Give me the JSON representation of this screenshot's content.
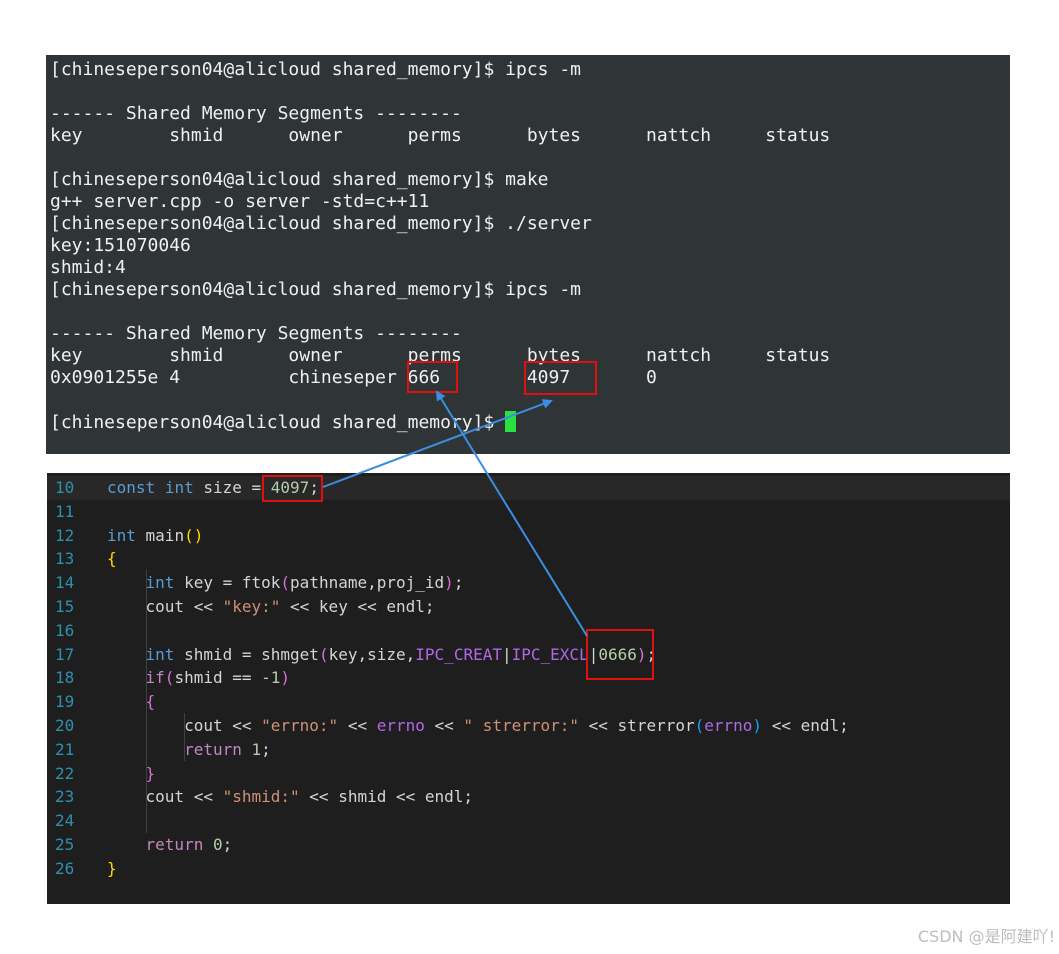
{
  "terminal": {
    "lines": [
      "[chineseperson04@alicloud shared_memory]$ ipcs -m",
      "",
      "------ Shared Memory Segments --------",
      "key        shmid      owner      perms      bytes      nattch     status",
      "",
      "[chineseperson04@alicloud shared_memory]$ make",
      "g++ server.cpp -o server -std=c++11",
      "[chineseperson04@alicloud shared_memory]$ ./server",
      "key:151070046",
      "shmid:4",
      "[chineseperson04@alicloud shared_memory]$ ipcs -m",
      "",
      "------ Shared Memory Segments --------",
      "key        shmid      owner      perms      bytes      nattch     status",
      "0x0901255e 4          chineseper 666        4097       0",
      ""
    ],
    "prompt": "[chineseperson04@alicloud shared_memory]$ ",
    "cursor_color": "#29e13f"
  },
  "editor": {
    "line_numbers": [
      "10",
      "11",
      "12",
      "13",
      "14",
      "15",
      "16",
      "17",
      "18",
      "19",
      "20",
      "21",
      "22",
      "23",
      "24",
      "25",
      "26"
    ],
    "code": [
      [
        [
          "kw",
          "const"
        ],
        [
          "pl",
          " "
        ],
        [
          "kw",
          "int"
        ],
        [
          "pl",
          " size = "
        ],
        [
          "num",
          "4097"
        ],
        [
          "pl",
          ";"
        ]
      ],
      [],
      [
        [
          "kw",
          "int"
        ],
        [
          "pl",
          " main"
        ],
        [
          "p1",
          "()"
        ]
      ],
      [
        [
          "p1",
          "{"
        ]
      ],
      [
        [
          "pl",
          "    "
        ],
        [
          "kw",
          "int"
        ],
        [
          "pl",
          " key = ftok"
        ],
        [
          "p2",
          "("
        ],
        [
          "pl",
          "pathname,proj_id"
        ],
        [
          "p2",
          ")"
        ],
        [
          "pl",
          ";"
        ]
      ],
      [
        [
          "pl",
          "    cout << "
        ],
        [
          "str",
          "\"key:\""
        ],
        [
          "pl",
          " << key << endl;"
        ]
      ],
      [],
      [
        [
          "pl",
          "    "
        ],
        [
          "kw",
          "int"
        ],
        [
          "pl",
          " shmid = shmget"
        ],
        [
          "p2",
          "("
        ],
        [
          "pl",
          "key,size,"
        ],
        [
          "mac",
          "IPC_CREAT"
        ],
        [
          "pl",
          "|"
        ],
        [
          "mac",
          "IPC_EXCL"
        ],
        [
          "pl",
          "|"
        ],
        [
          "num",
          "0666"
        ],
        [
          "p2",
          ")"
        ],
        [
          "pl",
          ";"
        ]
      ],
      [
        [
          "pl",
          "    "
        ],
        [
          "kw2",
          "if"
        ],
        [
          "p2",
          "("
        ],
        [
          "pl",
          "shmid == "
        ],
        [
          "num",
          "-1"
        ],
        [
          "p2",
          ")"
        ]
      ],
      [
        [
          "pl",
          "    "
        ],
        [
          "p2",
          "{"
        ]
      ],
      [
        [
          "pl",
          "        cout << "
        ],
        [
          "str",
          "\"errno:\""
        ],
        [
          "pl",
          " << "
        ],
        [
          "mac",
          "errno"
        ],
        [
          "pl",
          " << "
        ],
        [
          "str",
          "\" strerror:\""
        ],
        [
          "pl",
          " << strerror"
        ],
        [
          "p3",
          "("
        ],
        [
          "mac",
          "errno"
        ],
        [
          "p3",
          ")"
        ],
        [
          "pl",
          " << endl;"
        ]
      ],
      [
        [
          "pl",
          "        "
        ],
        [
          "kw2",
          "return"
        ],
        [
          "pl",
          " "
        ],
        [
          "num",
          "1"
        ],
        [
          "pl",
          ";"
        ]
      ],
      [
        [
          "pl",
          "    "
        ],
        [
          "p2",
          "}"
        ]
      ],
      [
        [
          "pl",
          "    cout << "
        ],
        [
          "str",
          "\"shmid:\""
        ],
        [
          "pl",
          " << shmid << endl;"
        ]
      ],
      [],
      [
        [
          "pl",
          "    "
        ],
        [
          "kw2",
          "return"
        ],
        [
          "pl",
          " "
        ],
        [
          "num",
          "0"
        ],
        [
          "pl",
          ";"
        ]
      ],
      [
        [
          "p1",
          "}"
        ]
      ]
    ],
    "colors": {
      "background": "#1e1e1e",
      "line_number": "#2b91af",
      "keyword": "#569cd6",
      "control": "#c586c0",
      "string": "#ce9178",
      "number": "#b5cea8",
      "macro": "#b267e6"
    }
  },
  "annotations": {
    "box_color": "#e01010",
    "arrow_color": "#3b8fe0"
  },
  "watermark": "CSDN @是阿建吖!"
}
